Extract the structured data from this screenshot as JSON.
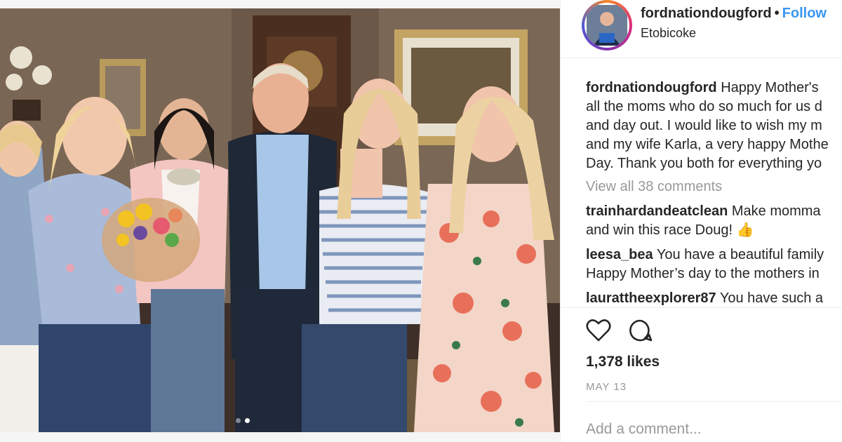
{
  "post": {
    "username": "fordnationdougford",
    "separator": "•",
    "follow_label": "Follow",
    "location": "Etobicoke",
    "caption": {
      "user": "fordnationdougford",
      "lines": [
        "Happy Mother's",
        "all the moms who do so much for us d",
        "and day out. I would like to wish my m",
        "and my wife Karla, a very happy Mothe",
        "Day. Thank you both for everything yo"
      ]
    },
    "view_all_comments": "View all 38 comments",
    "comments": [
      {
        "user": "trainhardandeatclean",
        "lines": [
          "Make momma",
          "and win this race Doug! 👍"
        ]
      },
      {
        "user": "leesa_bea",
        "lines": [
          "You have a beautiful family",
          "Happy Mother’s day to the mothers in"
        ]
      },
      {
        "user": "laurattheexplorer87",
        "lines": [
          "You have such a"
        ]
      }
    ],
    "likes": "1,378 likes",
    "date": "MAY 13",
    "add_comment_placeholder": "Add a comment...",
    "carousel": {
      "count": 2,
      "active_index": 1
    }
  },
  "icons": [
    "heart-icon",
    "comment-icon"
  ],
  "colors": {
    "link": "#3897f0",
    "muted": "#999999",
    "text": "#262626"
  }
}
